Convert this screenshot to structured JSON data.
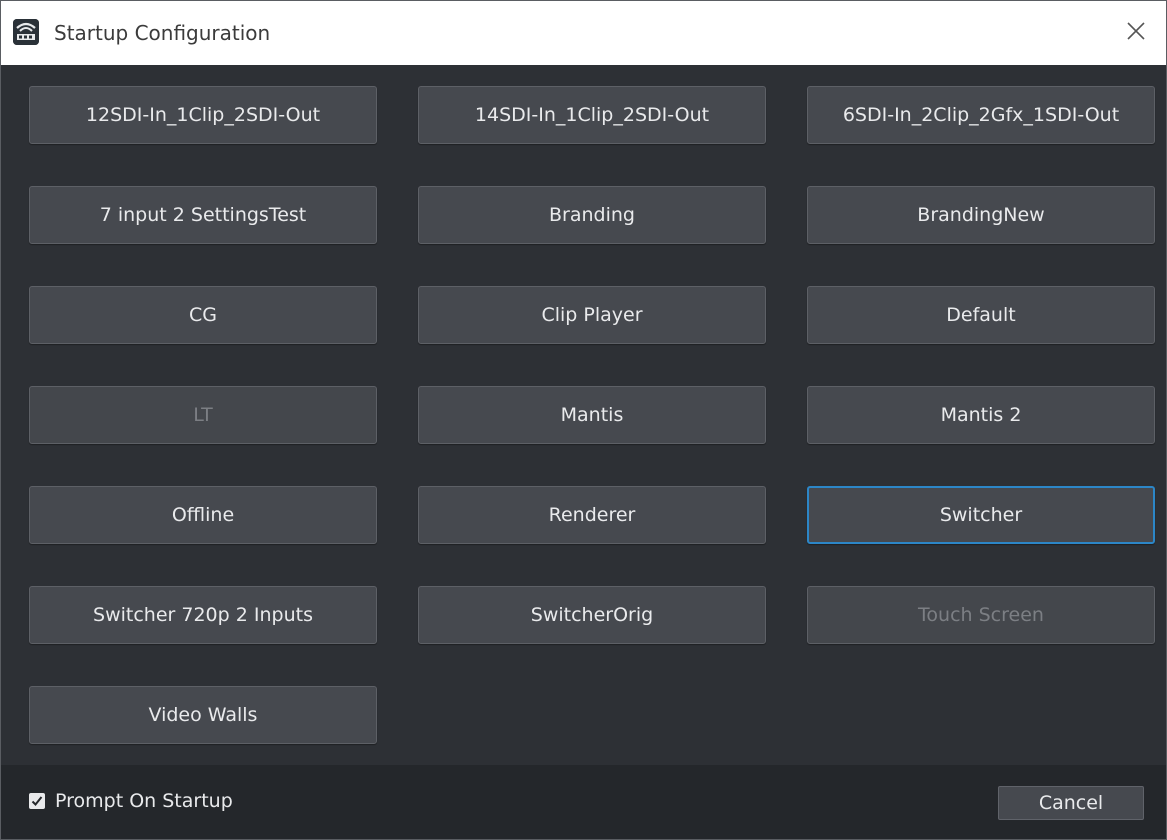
{
  "window": {
    "title": "Startup Configuration",
    "close_icon": "close-icon",
    "app_icon": "app-logo-icon"
  },
  "configurations": [
    {
      "label": "12SDI-In_1Clip_2SDI-Out",
      "name": "config-12sdi-in-1clip-2sdi-out",
      "state": "normal"
    },
    {
      "label": "14SDI-In_1Clip_2SDI-Out",
      "name": "config-14sdi-in-1clip-2sdi-out",
      "state": "normal"
    },
    {
      "label": "6SDI-In_2Clip_2Gfx_1SDI-Out",
      "name": "config-6sdi-in-2clip-2gfx-1sdi-out",
      "state": "normal"
    },
    {
      "label": "7 input 2 SettingsTest",
      "name": "config-7-input-2-settingstest",
      "state": "normal"
    },
    {
      "label": "Branding",
      "name": "config-branding",
      "state": "normal"
    },
    {
      "label": "BrandingNew",
      "name": "config-brandingnew",
      "state": "normal"
    },
    {
      "label": "CG",
      "name": "config-cg",
      "state": "normal"
    },
    {
      "label": "Clip Player",
      "name": "config-clip-player",
      "state": "normal"
    },
    {
      "label": "Default",
      "name": "config-default",
      "state": "normal"
    },
    {
      "label": "LT",
      "name": "config-lt",
      "state": "disabled"
    },
    {
      "label": "Mantis",
      "name": "config-mantis",
      "state": "normal"
    },
    {
      "label": "Mantis 2",
      "name": "config-mantis-2",
      "state": "normal"
    },
    {
      "label": "Offline",
      "name": "config-offline",
      "state": "normal"
    },
    {
      "label": "Renderer",
      "name": "config-renderer",
      "state": "normal"
    },
    {
      "label": "Switcher",
      "name": "config-switcher",
      "state": "selected"
    },
    {
      "label": "Switcher 720p 2 Inputs",
      "name": "config-switcher-720p-2-inputs",
      "state": "normal"
    },
    {
      "label": "SwitcherOrig",
      "name": "config-switcherorig",
      "state": "normal"
    },
    {
      "label": "Touch Screen",
      "name": "config-touch-screen",
      "state": "disabled"
    },
    {
      "label": "Video Walls",
      "name": "config-video-walls",
      "state": "normal"
    }
  ],
  "footer": {
    "prompt_label": "Prompt On Startup",
    "prompt_checked": true,
    "cancel_label": "Cancel"
  },
  "colors": {
    "background": "#2d3035",
    "button": "#46494f",
    "selected_border": "#2c86c7",
    "footer": "#24272b",
    "text": "#e9eaec",
    "disabled_text": "#7c7f84"
  }
}
